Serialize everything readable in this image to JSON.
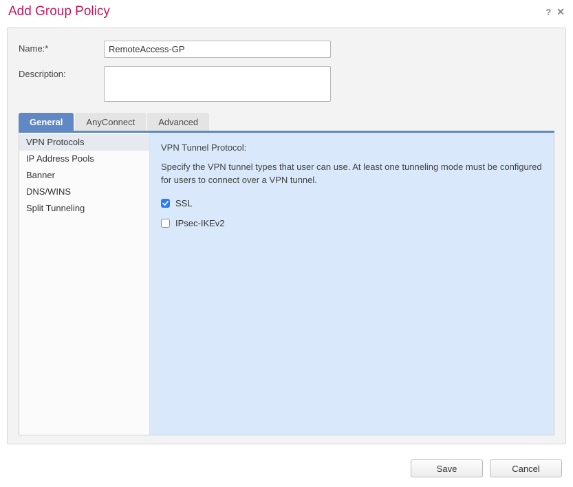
{
  "dialog": {
    "title": "Add Group Policy"
  },
  "form": {
    "name_label": "Name:*",
    "name_value": "RemoteAccess-GP",
    "description_label": "Description:",
    "description_value": ""
  },
  "tabs": [
    {
      "label": "General",
      "active": true
    },
    {
      "label": "AnyConnect",
      "active": false
    },
    {
      "label": "Advanced",
      "active": false
    }
  ],
  "sidebar": {
    "items": [
      {
        "label": "VPN Protocols",
        "active": true
      },
      {
        "label": "IP Address Pools",
        "active": false
      },
      {
        "label": "Banner",
        "active": false
      },
      {
        "label": "DNS/WINS",
        "active": false
      },
      {
        "label": "Split Tunneling",
        "active": false
      }
    ]
  },
  "content": {
    "heading": "VPN Tunnel Protocol:",
    "description": "Specify the VPN tunnel types that user can use. At least one tunneling mode must be configured for users to connect over a VPN tunnel.",
    "options": [
      {
        "label": "SSL",
        "checked": true
      },
      {
        "label": "IPsec-IKEv2",
        "checked": false
      }
    ]
  },
  "footer": {
    "save": "Save",
    "cancel": "Cancel"
  }
}
